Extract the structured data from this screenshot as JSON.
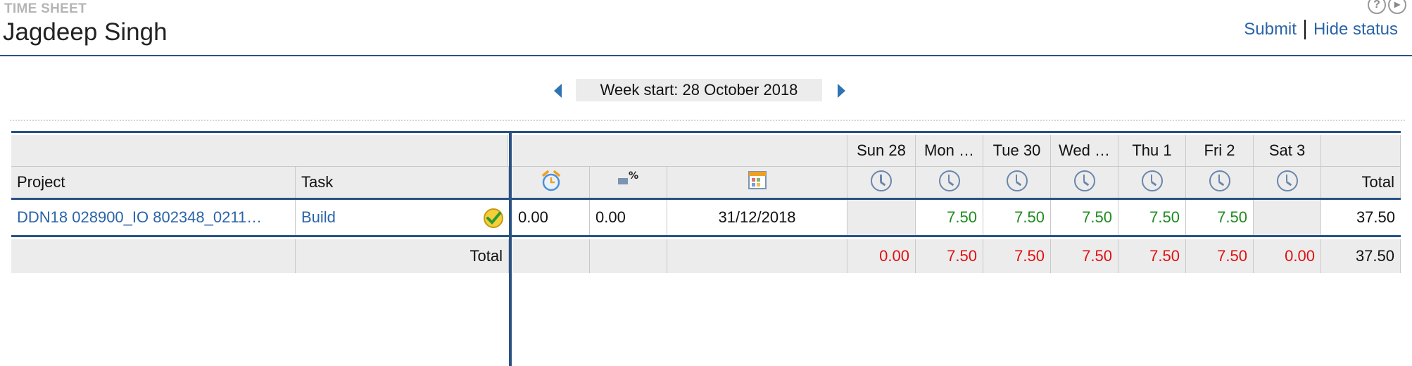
{
  "header": {
    "eyebrow": "TIME SHEET",
    "user_name": "Jagdeep Singh",
    "submit_label": "Submit",
    "hide_status_label": "Hide status"
  },
  "week": {
    "label": "Week start: 28 October 2018"
  },
  "columns": {
    "project": "Project",
    "task": "Task",
    "total": "Total",
    "days": [
      "Sun 28",
      "Mon …",
      "Tue 30",
      "Wed …",
      "Thu 1",
      "Fri 2",
      "Sat 3"
    ]
  },
  "row": {
    "project": "DDN18 028900_IO 802348_0211…",
    "task": "Build",
    "col1": "0.00",
    "col2": "0.00",
    "date": "31/12/2018",
    "days": [
      "",
      "7.50",
      "7.50",
      "7.50",
      "7.50",
      "7.50",
      ""
    ],
    "total": "37.50"
  },
  "totals": {
    "label": "Total",
    "days": [
      "0.00",
      "7.50",
      "7.50",
      "7.50",
      "7.50",
      "7.50",
      "0.00"
    ],
    "total": "37.50"
  },
  "colors": {
    "accent": "#2a5285",
    "link": "#2a64a8",
    "positive": "#1f8b1f",
    "negative": "#e01010"
  },
  "icons": {
    "col1": "alarm-clock-icon",
    "col2": "percent-bar-icon",
    "col3": "calendar-grid-icon",
    "day": "clock-icon",
    "status": "approved-check-icon"
  }
}
